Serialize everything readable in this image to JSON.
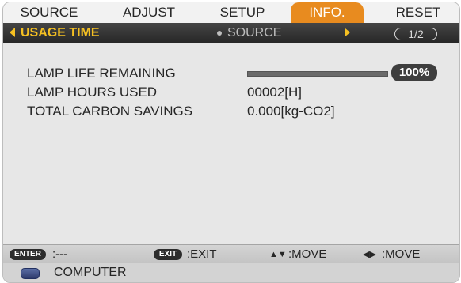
{
  "tabs": [
    "SOURCE",
    "ADJUST",
    "SETUP",
    "INFO.",
    "RESET"
  ],
  "subnav": {
    "title": "USAGE TIME",
    "next": "SOURCE",
    "page": "1/2"
  },
  "info": {
    "lamp_life_label": "LAMP LIFE REMAINING",
    "lamp_life_percent": "100%",
    "lamp_life_fraction": 1.0,
    "lamp_hours_label": "LAMP HOURS USED",
    "lamp_hours_value": "00002[H]",
    "carbon_label": "TOTAL CARBON SAVINGS",
    "carbon_value": "0.000[kg-CO2]"
  },
  "footer": {
    "enter_key": "ENTER",
    "enter_text": ":---",
    "exit_key": "EXIT",
    "exit_text": ":EXIT",
    "move_ud_text": ":MOVE",
    "move_lr_text": ":MOVE"
  },
  "status": {
    "source_label": "COMPUTER"
  },
  "colors": {
    "accent": "#e88b1f",
    "highlight": "#f5c022"
  }
}
